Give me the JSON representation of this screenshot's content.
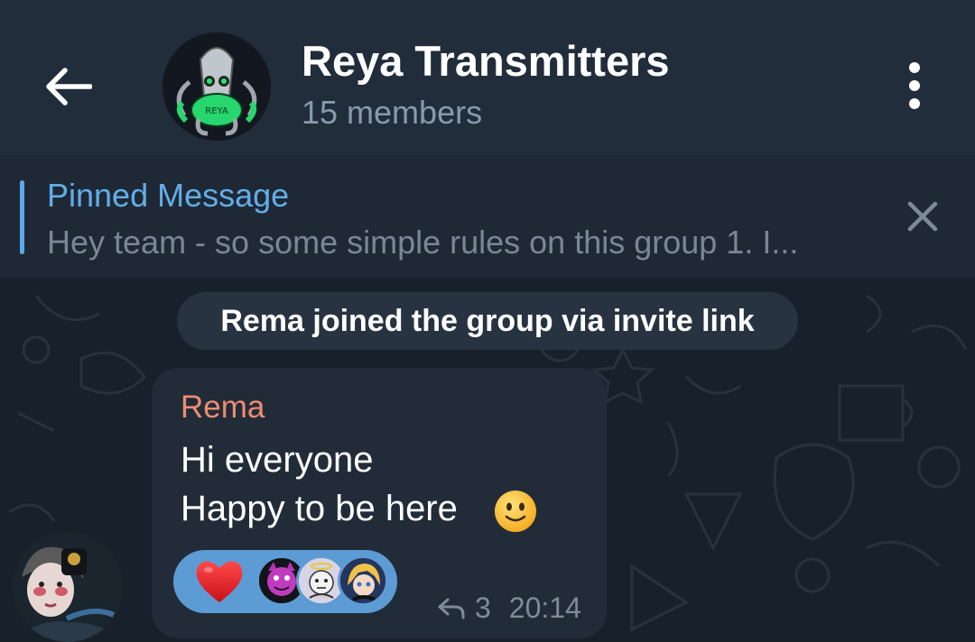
{
  "header": {
    "back_icon": "arrow-left-icon",
    "group_title": "Reya Transmitters",
    "members": "15 members",
    "avatar_label": "REYA",
    "menu_icon": "more-vertical-icon"
  },
  "pinned": {
    "label": "Pinned Message",
    "preview": "Hey team - so some simple rules on this group 1. I...",
    "close_icon": "close-icon"
  },
  "chat": {
    "service_message": "Rema joined the group via invite link",
    "message": {
      "sender": "Rema",
      "line1": "Hi everyone",
      "line2": "Happy to be here",
      "emoji": "slightly-smiling-face",
      "reaction_emoji": "red-heart",
      "replies": "3",
      "time": "20:14"
    }
  },
  "colors": {
    "header_bg": "#212d3b",
    "chat_bg": "#18212b",
    "accent_blue": "#62aee8",
    "sender_name": "#ef8b73",
    "reaction_pill": "#5d9bd4",
    "bubble_bg": "#212c38"
  }
}
